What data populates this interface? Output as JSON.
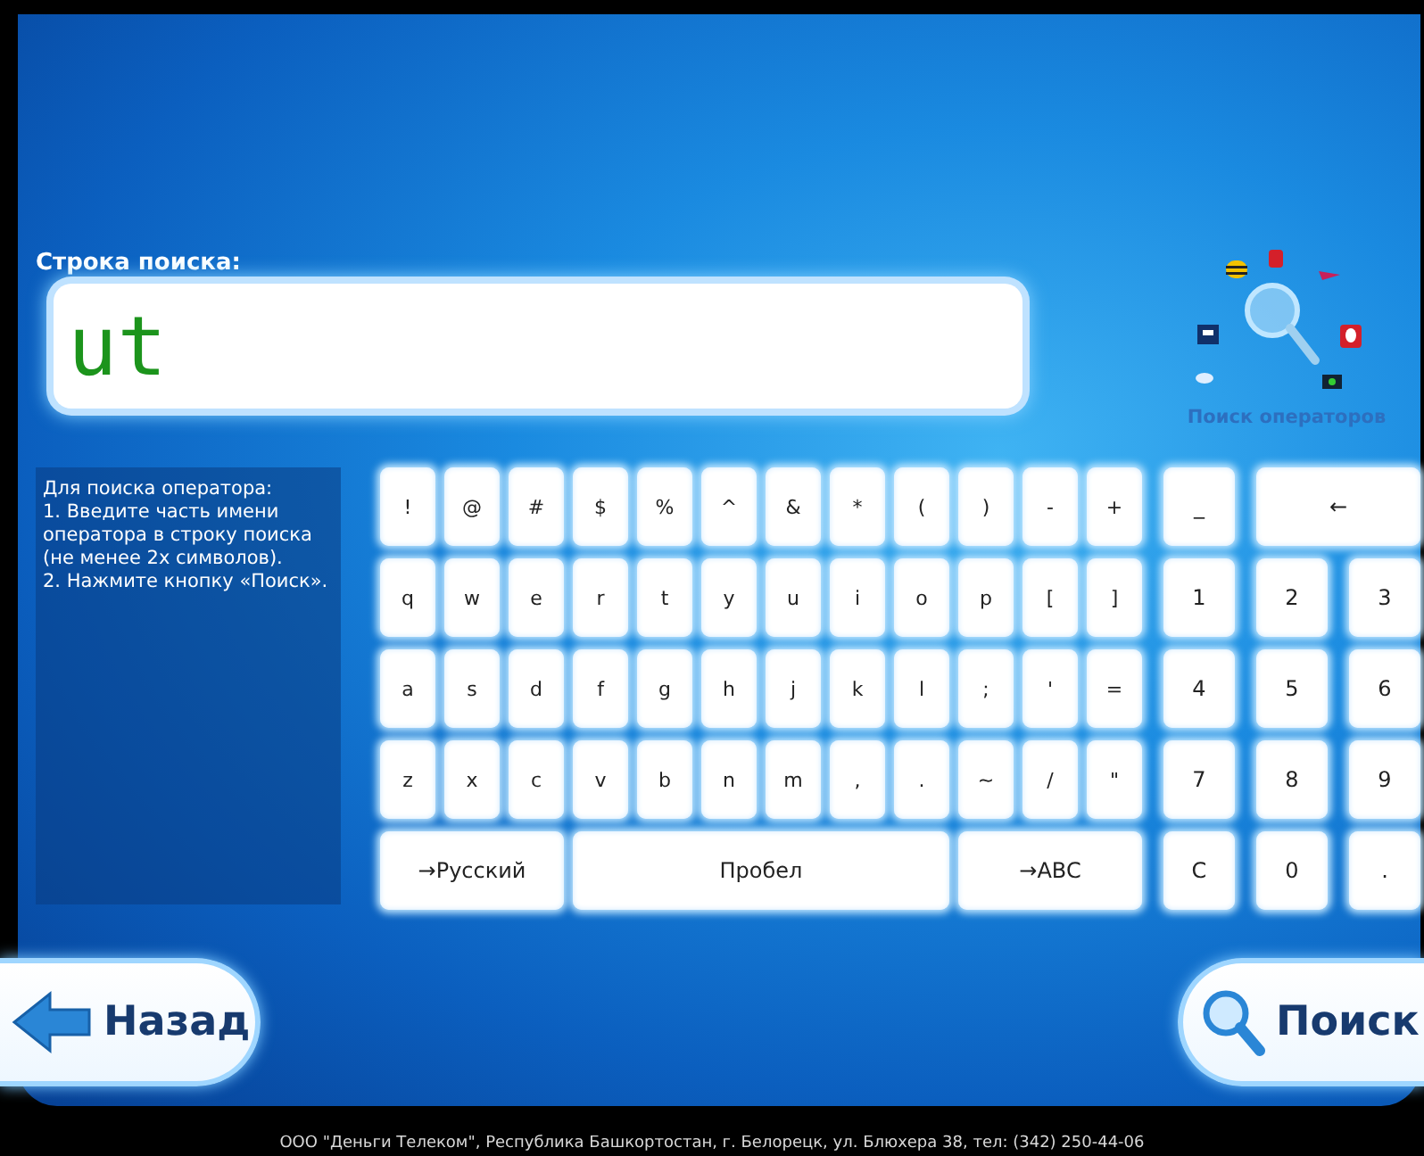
{
  "search": {
    "label": "Строка поиска:",
    "value": "ut"
  },
  "operators": {
    "caption": "Поиск операторов"
  },
  "instructions": [
    "Для поиска оператора:",
    "1. Введите часть имени оператора в строку поиска (не менее 2х символов).",
    "2. Нажмите кнопку «Поиск»."
  ],
  "keyboard": {
    "rows": [
      [
        "!",
        "@",
        "#",
        "$",
        "%",
        "^",
        "&",
        "*",
        "(",
        ")",
        "-",
        "+"
      ],
      [
        "q",
        "w",
        "e",
        "r",
        "t",
        "y",
        "u",
        "i",
        "o",
        "p",
        "[",
        "]"
      ],
      [
        "a",
        "s",
        "d",
        "f",
        "g",
        "h",
        "j",
        "k",
        "l",
        ";",
        "'",
        "="
      ],
      [
        "z",
        "x",
        "c",
        "v",
        "b",
        "n",
        "m",
        ",",
        ".",
        "~",
        "/",
        "\""
      ]
    ],
    "bottom": [
      {
        "label": "→Русский",
        "kind": "switch"
      },
      {
        "label": "Пробел",
        "kind": "space"
      },
      {
        "label": "→ABC",
        "kind": "switch"
      }
    ],
    "numpad": [
      {
        "label": "_",
        "kind": "key"
      },
      {
        "label": "←",
        "kind": "backspace"
      },
      {
        "label": "1",
        "kind": "key"
      },
      {
        "label": "2",
        "kind": "key"
      },
      {
        "label": "3",
        "kind": "key"
      },
      {
        "label": "4",
        "kind": "key"
      },
      {
        "label": "5",
        "kind": "key"
      },
      {
        "label": "6",
        "kind": "key"
      },
      {
        "label": "7",
        "kind": "key"
      },
      {
        "label": "8",
        "kind": "key"
      },
      {
        "label": "9",
        "kind": "key"
      },
      {
        "label": "C",
        "kind": "key"
      },
      {
        "label": "0",
        "kind": "key"
      },
      {
        "label": ".",
        "kind": "key"
      }
    ]
  },
  "buttons": [
    {
      "label": "Назад",
      "kind": "back"
    },
    {
      "label": "Поиск",
      "kind": "search"
    }
  ],
  "footer": "ООО \"Деньги Телеком\", Республика Башкортостан, г. Белорецк, ул. Блюхера 38, тел: (342) 250-44-06"
}
